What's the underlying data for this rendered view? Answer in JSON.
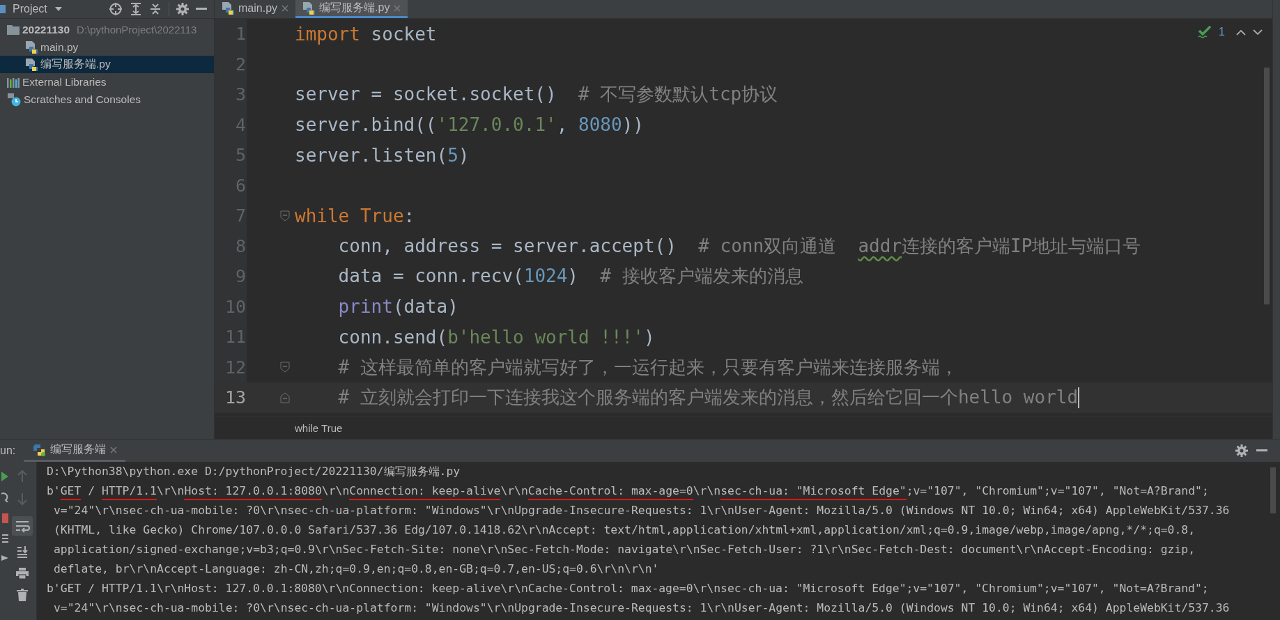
{
  "project_panel": {
    "title": "Project",
    "tree": [
      {
        "label": "20221130",
        "path": "D:\\pythonProject\\2022113",
        "kind": "folder",
        "selected": false,
        "children": [
          {
            "label": "main.py",
            "kind": "python_file",
            "selected": false
          },
          {
            "label": "编写服务端.py",
            "kind": "python_file",
            "selected": true
          }
        ]
      },
      {
        "label": "External Libraries",
        "kind": "library",
        "selected": false
      },
      {
        "label": "Scratches and Consoles",
        "kind": "scratches",
        "selected": false
      }
    ]
  },
  "tabs": [
    {
      "label": "main.py",
      "selected": false
    },
    {
      "label": "编写服务端.py",
      "selected": true
    }
  ],
  "inspection": {
    "count": "1"
  },
  "editor": {
    "lines": [
      {
        "number": "1",
        "current": false,
        "fold_start": false,
        "fold_end": false,
        "tokens": [
          {
            "kind": "keyword",
            "text": "import"
          },
          {
            "kind": "plain",
            "text": " socket"
          }
        ]
      },
      {
        "number": "2",
        "current": false,
        "fold_start": false,
        "fold_end": false
      },
      {
        "number": "3",
        "current": false,
        "fold_start": false,
        "fold_end": false,
        "tokens": [
          {
            "kind": "plain",
            "text": "server = socket.socket()  "
          },
          {
            "kind": "comment",
            "text": "# 不写参数默认tcp协议"
          }
        ]
      },
      {
        "number": "4",
        "current": false,
        "fold_start": false,
        "fold_end": false,
        "tokens": [
          {
            "kind": "plain",
            "text": "server.bind(("
          },
          {
            "kind": "string",
            "text": "'127.0.0.1'"
          },
          {
            "kind": "plain",
            "text": ", "
          },
          {
            "kind": "number",
            "text": "8080"
          },
          {
            "kind": "plain",
            "text": "))"
          }
        ]
      },
      {
        "number": "5",
        "current": false,
        "fold_start": false,
        "fold_end": false,
        "tokens": [
          {
            "kind": "plain",
            "text": "server.listen("
          },
          {
            "kind": "number",
            "text": "5"
          },
          {
            "kind": "plain",
            "text": ")"
          }
        ]
      },
      {
        "number": "6",
        "current": false,
        "fold_start": false,
        "fold_end": false
      },
      {
        "number": "7",
        "current": false,
        "fold_start": true,
        "fold_end": false,
        "tokens": [
          {
            "kind": "keyword",
            "text": "while True"
          },
          {
            "kind": "plain",
            "text": ":"
          }
        ]
      },
      {
        "number": "8",
        "current": false,
        "fold_start": false,
        "fold_end": false,
        "tokens": [
          {
            "kind": "plain",
            "text": "    conn, address = server.accept()  "
          },
          {
            "kind": "comment",
            "text": "# conn双向通道  "
          },
          {
            "kind": "typo",
            "text": "addr"
          },
          {
            "kind": "comment",
            "text": "连接的客户端IP地址与端口号"
          }
        ]
      },
      {
        "number": "9",
        "current": false,
        "fold_start": false,
        "fold_end": false,
        "tokens": [
          {
            "kind": "plain",
            "text": "    data = conn.recv("
          },
          {
            "kind": "number",
            "text": "1024"
          },
          {
            "kind": "plain",
            "text": ")  "
          },
          {
            "kind": "comment",
            "text": "# 接收客户端发来的消息"
          }
        ]
      },
      {
        "number": "10",
        "current": false,
        "fold_start": false,
        "fold_end": false,
        "tokens": [
          {
            "kind": "builtin",
            "text": "    print"
          },
          {
            "kind": "plain",
            "text": "(data)"
          }
        ]
      },
      {
        "number": "11",
        "current": false,
        "fold_start": false,
        "fold_end": false,
        "tokens": [
          {
            "kind": "plain",
            "text": "    conn.send("
          },
          {
            "kind": "string",
            "text": "b'hello world !!!'"
          },
          {
            "kind": "plain",
            "text": ")"
          }
        ]
      },
      {
        "number": "12",
        "current": false,
        "fold_start": true,
        "fold_end": false,
        "tokens": [
          {
            "kind": "comment",
            "text": "    # 这样最简单的客户端就写好了，一运行起来，只要有客户端来连接服务端，"
          }
        ]
      },
      {
        "number": "13",
        "current": true,
        "fold_start": false,
        "fold_end": true,
        "tokens": [
          {
            "kind": "comment",
            "text": "    # 立刻就会打印一下连接我这个服务端的客户端发来的消息，然后给它回一个hello world"
          }
        ]
      }
    ],
    "breadcrumb": "while True"
  },
  "run_panel": {
    "label": "un:",
    "tab": "编写服务端",
    "lines": [
      {
        "wrapped": false,
        "segments": [
          {
            "text": "D:\\Python38\\python.exe D:/pythonProject/20221130/编写服务端.py",
            "underlined": false
          }
        ]
      },
      {
        "wrapped": false,
        "segments": [
          {
            "text": "b'",
            "underlined": false
          },
          {
            "text": "GET",
            "underlined": true
          },
          {
            "text": " / ",
            "underlined": false
          },
          {
            "text": "HTTP/1.1",
            "underlined": true
          },
          {
            "text": "\\r\\n",
            "underlined": false
          },
          {
            "text": "Host: 127.0.0.1:8080",
            "underlined": true
          },
          {
            "text": "\\r\\n",
            "underlined": false
          },
          {
            "text": "Connection: keep-alive",
            "underlined": true
          },
          {
            "text": "\\r\\n",
            "underlined": false
          },
          {
            "text": "Cache-Control: max-age=0",
            "underlined": true
          },
          {
            "text": "\\r\\n",
            "underlined": false
          },
          {
            "text": "sec-ch-ua: \"Microsoft Edge\"",
            "underlined": true
          },
          {
            "text": ";v=\"107\", \"Chromium\";v=\"107\", \"Not=A?Brand\";",
            "underlined": false
          }
        ]
      },
      {
        "wrapped": true,
        "segments": [
          {
            "text": "v=\"24\"\\r\\nsec-ch-ua-mobile: ?0\\r\\nsec-ch-ua-platform: \"Windows\"\\r\\nUpgrade-Insecure-Requests: 1\\r\\nUser-Agent: Mozilla/5.0 (Windows NT 10.0; Win64; x64) AppleWebKit/537.36",
            "underlined": false
          }
        ]
      },
      {
        "wrapped": true,
        "segments": [
          {
            "text": "(KHTML, like Gecko) Chrome/107.0.0.0 Safari/537.36 Edg/107.0.1418.62\\r\\nAccept: text/html,application/xhtml+xml,application/xml;q=0.9,image/webp,image/apng,*/*;q=0.8,",
            "underlined": false
          }
        ]
      },
      {
        "wrapped": true,
        "segments": [
          {
            "text": "application/signed-exchange;v=b3;q=0.9\\r\\nSec-Fetch-Site: none\\r\\nSec-Fetch-Mode: navigate\\r\\nSec-Fetch-User: ?1\\r\\nSec-Fetch-Dest: document\\r\\nAccept-Encoding: gzip,",
            "underlined": false
          }
        ]
      },
      {
        "wrapped": true,
        "segments": [
          {
            "text": "deflate, br\\r\\nAccept-Language: zh-CN,zh;q=0.9,en;q=0.8,en-GB;q=0.7,en-US;q=0.6\\r\\n\\r\\n'",
            "underlined": false
          }
        ]
      },
      {
        "wrapped": false,
        "segments": [
          {
            "text": "b'GET / HTTP/1.1\\r\\nHost: 127.0.0.1:8080\\r\\nConnection: keep-alive\\r\\nCache-Control: max-age=0\\r\\nsec-ch-ua: \"Microsoft Edge\";v=\"107\", \"Chromium\";v=\"107\", \"Not=A?Brand\";",
            "underlined": false
          }
        ]
      },
      {
        "wrapped": true,
        "segments": [
          {
            "text": "v=\"24\"\\r\\nsec-ch-ua-mobile: ?0\\r\\nsec-ch-ua-platform: \"Windows\"\\r\\nUpgrade-Insecure-Requests: 1\\r\\nUser-Agent: Mozilla/5.0 (Windows NT 10.0; Win64; x64) AppleWebKit/537.36",
            "underlined": false
          }
        ]
      }
    ]
  }
}
